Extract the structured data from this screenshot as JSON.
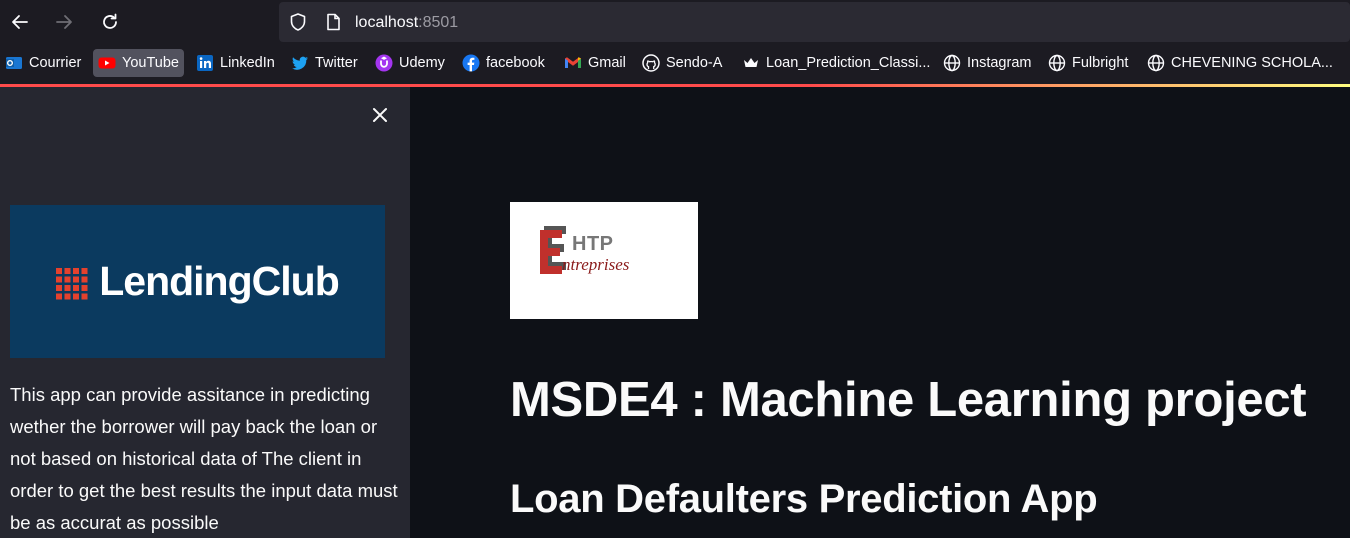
{
  "browser": {
    "url_host": "localhost",
    "url_port": ":8501",
    "icons": [
      "back-arrow-icon",
      "forward-arrow-icon",
      "reload-icon",
      "shield-icon",
      "page-icon"
    ]
  },
  "bookmarks": [
    {
      "label": "Courrier",
      "icon": "outlook-icon",
      "color": "#1976d2"
    },
    {
      "label": "YouTube",
      "icon": "youtube-icon",
      "color": "#ff0000"
    },
    {
      "label": "LinkedIn",
      "icon": "linkedin-icon",
      "color": "#0a66c2"
    },
    {
      "label": "Twitter",
      "icon": "twitter-icon",
      "color": "#1da1f2"
    },
    {
      "label": "Udemy",
      "icon": "udemy-icon",
      "color": "#a435f0"
    },
    {
      "label": "facebook",
      "icon": "facebook-icon",
      "color": "#1877f2"
    },
    {
      "label": "Gmail",
      "icon": "gmail-icon",
      "color": "#ea4335"
    },
    {
      "label": "Sendo-A",
      "icon": "github-icon",
      "color": "#ffffff"
    },
    {
      "label": "Loan_Prediction_Classi...",
      "icon": "crown-icon",
      "color": "#ffffff"
    },
    {
      "label": "Instagram",
      "icon": "globe-icon",
      "color": "#ffffff"
    },
    {
      "label": "Fulbright",
      "icon": "globe-icon",
      "color": "#ffffff"
    },
    {
      "label": "CHEVENING SCHOLA...",
      "icon": "globe-icon",
      "color": "#ffffff"
    }
  ],
  "sidebar": {
    "logo_text": "LendingClub",
    "description": "This app can provide assitance in predicting wether the borrower will pay back the loan or not based on historical data of The client in order to get the best results the input data must be as accurat as possible"
  },
  "main": {
    "logo_top": "HTP",
    "logo_bottom": "ntreprises",
    "title": "MSDE4 : Machine Learning project",
    "subtitle": "Loan Defaulters Prediction App"
  },
  "colors": {
    "accent": "#ff4b4b",
    "sidebar_bg": "#262730",
    "main_bg": "#0e1117",
    "lendingclub_bg": "#0b3a5f",
    "lendingclub_mark": "#e4412d"
  }
}
